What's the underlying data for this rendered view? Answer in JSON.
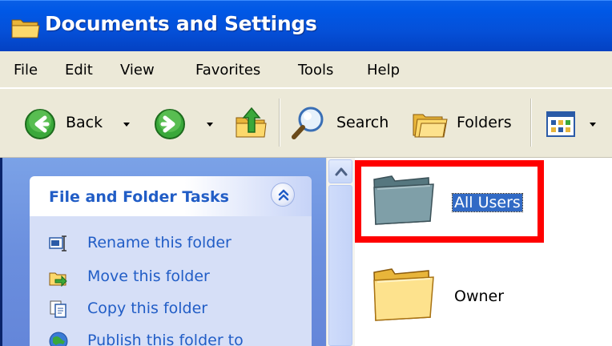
{
  "window": {
    "title": "Documents and Settings"
  },
  "menu": {
    "items": [
      "File",
      "Edit",
      "View",
      "Favorites",
      "Tools",
      "Help"
    ]
  },
  "toolbar": {
    "back_label": "Back",
    "search_label": "Search",
    "folders_label": "Folders"
  },
  "tasks": {
    "header": "File and Folder Tasks",
    "items": [
      {
        "label": "Rename this folder",
        "icon": "rename-icon"
      },
      {
        "label": "Move this folder",
        "icon": "move-icon"
      },
      {
        "label": "Copy this folder",
        "icon": "copy-icon"
      },
      {
        "label": "Publish this folder to",
        "icon": "publish-icon"
      }
    ]
  },
  "files": [
    {
      "label": "All Users",
      "selected": true
    },
    {
      "label": "Owner",
      "selected": false
    }
  ],
  "colors": {
    "titlebar": "#0058e6",
    "menubar": "#ece9d8",
    "task_pane": "#6b8fde",
    "task_text": "#215dc6",
    "selection": "#316ac5",
    "highlight": "#ff0000"
  }
}
